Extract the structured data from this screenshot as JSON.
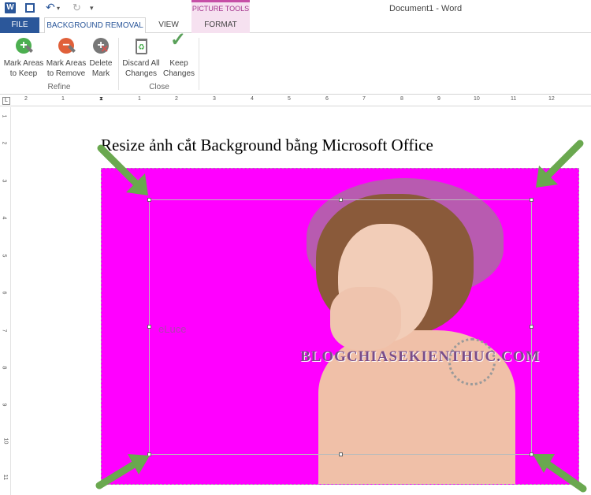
{
  "titlebar": {
    "doc_title": "Document1 - Word",
    "app_icon_letter": "W",
    "contextual_group": "PICTURE TOOLS"
  },
  "tabs": {
    "file": "FILE",
    "background_removal": "BACKGROUND REMOVAL",
    "view": "VIEW",
    "format": "FORMAT"
  },
  "ribbon": {
    "refine": {
      "label": "Refine",
      "mark_keep": [
        "Mark Areas",
        "to Keep"
      ],
      "mark_remove": [
        "Mark Areas",
        "to Remove"
      ],
      "delete_mark": [
        "Delete",
        "Mark"
      ]
    },
    "close": {
      "label": "Close",
      "discard": [
        "Discard All",
        "Changes"
      ],
      "keep": [
        "Keep",
        "Changes"
      ]
    }
  },
  "ruler": {
    "h_ticks": [
      "2",
      "1",
      "1",
      "2",
      "3",
      "4",
      "5",
      "6",
      "7",
      "8",
      "9",
      "10",
      "11",
      "12"
    ],
    "v_ticks": [
      "1",
      "2",
      "3",
      "4",
      "5",
      "6",
      "7",
      "8",
      "9",
      "10",
      "11"
    ],
    "corner": "L"
  },
  "document": {
    "heading": "Resize ảnh cắt Background bằng Microsoft Office",
    "picture_watermark": "BLOGCHIASEKIENTHUC.COM",
    "picture_logo": "eLuce"
  },
  "colors": {
    "word_blue": "#2b579a",
    "remove_magenta": "#ff00ff",
    "arrow_green": "#6aa84f",
    "picture_tools_pink": "#c64fa6"
  }
}
